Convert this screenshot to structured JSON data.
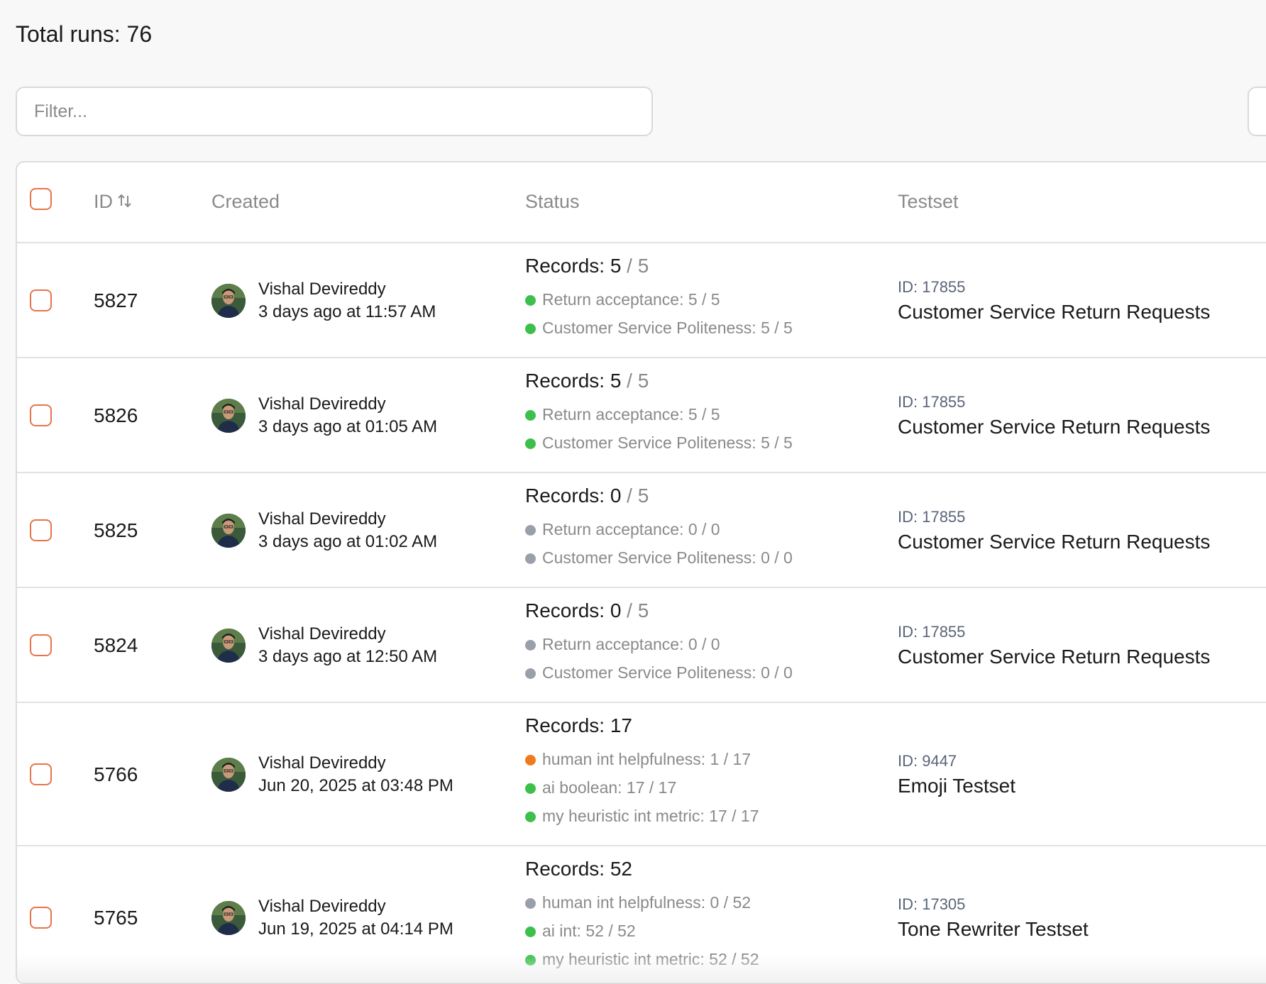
{
  "header": {
    "total_runs": "Total runs: 76"
  },
  "filter": {
    "placeholder": "Filter..."
  },
  "colors": {
    "accent": "#e8744a",
    "success": "#3cc04b",
    "pending": "#9aa0ab",
    "partial": "#f07a1e"
  },
  "table": {
    "columns": {
      "id": "ID",
      "created": "Created",
      "status": "Status",
      "testset": "Testset"
    },
    "rows": [
      {
        "id": "5827",
        "user": "Vishal Devireddy",
        "created": "3 days ago at 11:57 AM",
        "records_done": "Records: 5",
        "records_total": " / 5",
        "metrics": [
          {
            "label": "Return acceptance: 5 / 5",
            "status": "success"
          },
          {
            "label": "Customer Service Politeness: 5 / 5",
            "status": "success"
          }
        ],
        "testset_id": "ID: 17855",
        "testset_name": "Customer Service Return Requests"
      },
      {
        "id": "5826",
        "user": "Vishal Devireddy",
        "created": "3 days ago at 01:05 AM",
        "records_done": "Records: 5",
        "records_total": " / 5",
        "metrics": [
          {
            "label": "Return acceptance: 5 / 5",
            "status": "success"
          },
          {
            "label": "Customer Service Politeness: 5 / 5",
            "status": "success"
          }
        ],
        "testset_id": "ID: 17855",
        "testset_name": "Customer Service Return Requests"
      },
      {
        "id": "5825",
        "user": "Vishal Devireddy",
        "created": "3 days ago at 01:02 AM",
        "records_done": "Records: 0",
        "records_total": " / 5",
        "metrics": [
          {
            "label": "Return acceptance: 0 / 0",
            "status": "pending"
          },
          {
            "label": "Customer Service Politeness: 0 / 0",
            "status": "pending"
          }
        ],
        "testset_id": "ID: 17855",
        "testset_name": "Customer Service Return Requests"
      },
      {
        "id": "5824",
        "user": "Vishal Devireddy",
        "created": "3 days ago at 12:50 AM",
        "records_done": "Records: 0",
        "records_total": " / 5",
        "metrics": [
          {
            "label": "Return acceptance: 0 / 0",
            "status": "pending"
          },
          {
            "label": "Customer Service Politeness: 0 / 0",
            "status": "pending"
          }
        ],
        "testset_id": "ID: 17855",
        "testset_name": "Customer Service Return Requests"
      },
      {
        "id": "5766",
        "user": "Vishal Devireddy",
        "created": "Jun 20, 2025 at 03:48 PM",
        "records_done": "Records: 17",
        "records_total": "",
        "metrics": [
          {
            "label": "human int helpfulness: 1 / 17",
            "status": "partial"
          },
          {
            "label": "ai boolean: 17 / 17",
            "status": "success"
          },
          {
            "label": "my heuristic int metric: 17 / 17",
            "status": "success"
          }
        ],
        "testset_id": "ID: 9447",
        "testset_name": "Emoji Testset"
      },
      {
        "id": "5765",
        "user": "Vishal Devireddy",
        "created": "Jun 19, 2025 at 04:14 PM",
        "records_done": "Records: 52",
        "records_total": "",
        "metrics": [
          {
            "label": "human int helpfulness: 0 / 52",
            "status": "pending"
          },
          {
            "label": "ai int: 52 / 52",
            "status": "success"
          },
          {
            "label": "my heuristic int metric: 52 / 52",
            "status": "success"
          }
        ],
        "testset_id": "ID: 17305",
        "testset_name": "Tone Rewriter Testset"
      }
    ]
  }
}
